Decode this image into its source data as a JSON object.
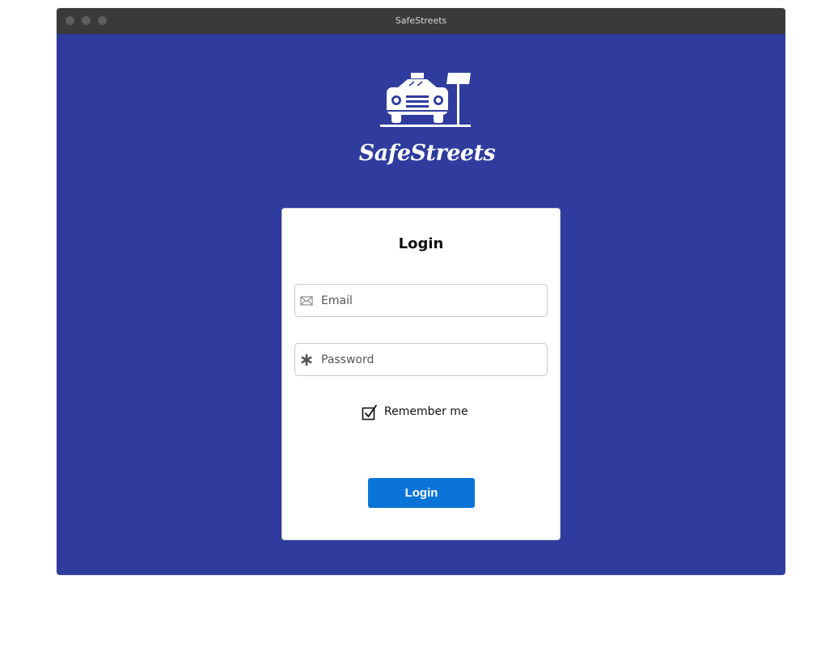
{
  "window": {
    "title": "SafeStreets"
  },
  "brand": {
    "name": "SafeStreets",
    "logo_icon": "taxi-street-sign-icon",
    "background_color": "#2f3c9e"
  },
  "login_form": {
    "title": "Login",
    "email": {
      "placeholder": "Email",
      "value": "",
      "icon": "envelope-icon"
    },
    "password": {
      "placeholder": "Password",
      "value": "",
      "icon": "asterisk-icon"
    },
    "remember_me": {
      "label": "Remember me",
      "checked": true
    },
    "submit_label": "Login",
    "submit_color": "#0a74d9"
  }
}
